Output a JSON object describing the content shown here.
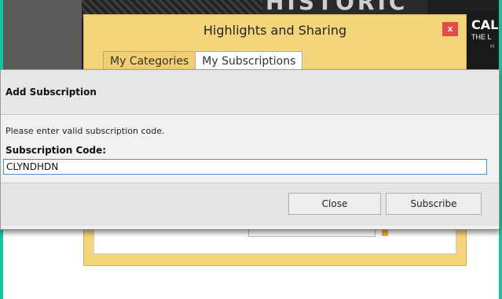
{
  "background": {
    "title_fragment": "HISTORIC",
    "right_title": "CAL",
    "right_line": "THE L",
    "right_small": "H"
  },
  "highlights_dialog": {
    "title": "Highlights and Sharing",
    "close_label": "x",
    "tabs": [
      {
        "label": "My Categories",
        "active": false
      },
      {
        "label": "My Subscriptions",
        "active": true
      }
    ]
  },
  "add_subscription": {
    "title": "Add Subscription",
    "message": "Please enter valid subscription code.",
    "field_label": "Subscription Code:",
    "field_value": "CLYNDHDN",
    "buttons": {
      "close": "Close",
      "subscribe": "Subscribe"
    }
  },
  "colors": {
    "accent_edge": "#19c2a0",
    "dialog_yellow": "#f5d57b",
    "close_red": "#e64b4b",
    "input_focus": "#4a90d0"
  }
}
